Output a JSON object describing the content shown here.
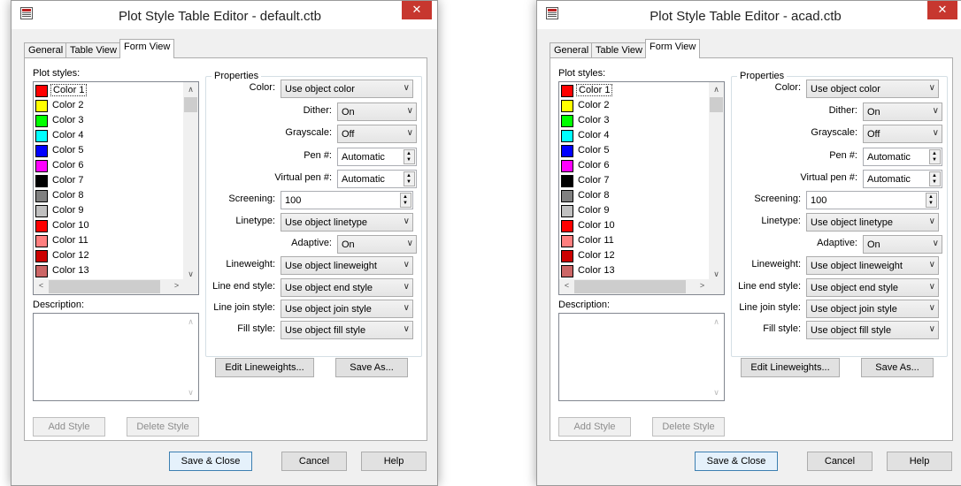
{
  "windows": [
    {
      "title": "Plot Style Table Editor - default.ctb",
      "tabs": [
        "General",
        "Table View",
        "Form View"
      ],
      "active_tab": "Form View",
      "plot_styles_label": "Plot styles:",
      "plot_styles": [
        {
          "label": "Color 1",
          "color": "#ff0000",
          "selected": true
        },
        {
          "label": "Color 2",
          "color": "#ffff00"
        },
        {
          "label": "Color 3",
          "color": "#00ff00"
        },
        {
          "label": "Color 4",
          "color": "#00ffff"
        },
        {
          "label": "Color 5",
          "color": "#0000ff"
        },
        {
          "label": "Color 6",
          "color": "#ff00ff"
        },
        {
          "label": "Color 7",
          "color": "#000000"
        },
        {
          "label": "Color 8",
          "color": "#808080"
        },
        {
          "label": "Color 9",
          "color": "#c0c0c0"
        },
        {
          "label": "Color 10",
          "color": "#ff0000"
        },
        {
          "label": "Color 11",
          "color": "#ff7f7f"
        },
        {
          "label": "Color 12",
          "color": "#cc0000"
        },
        {
          "label": "Color 13",
          "color": "#cc6666"
        }
      ],
      "description_label": "Description:",
      "add_style": "Add Style",
      "delete_style": "Delete Style",
      "properties_title": "Properties",
      "properties": {
        "color_label": "Color:",
        "color_value": "Use object color",
        "dither_label": "Dither:",
        "dither_value": "On",
        "grayscale_label": "Grayscale:",
        "grayscale_value": "Off",
        "pen_label": "Pen #:",
        "pen_value": "Automatic",
        "virtual_pen_label": "Virtual pen #:",
        "virtual_pen_value": "Automatic",
        "screening_label": "Screening:",
        "screening_value": "100",
        "linetype_label": "Linetype:",
        "linetype_value": "Use object linetype",
        "adaptive_label": "Adaptive:",
        "adaptive_value": "On",
        "lineweight_label": "Lineweight:",
        "lineweight_value": "Use object lineweight",
        "line_end_label": "Line end style:",
        "line_end_value": "Use object end style",
        "line_join_label": "Line join style:",
        "line_join_value": "Use object join style",
        "fill_label": "Fill style:",
        "fill_value": "Use object fill style"
      },
      "edit_lineweights": "Edit Lineweights...",
      "save_as": "Save As...",
      "save_close": "Save & Close",
      "cancel": "Cancel",
      "help": "Help"
    },
    {
      "title": "Plot Style Table Editor - acad.ctb",
      "tabs": [
        "General",
        "Table View",
        "Form View"
      ],
      "active_tab": "Form View",
      "plot_styles_label": "Plot styles:",
      "plot_styles": [
        {
          "label": "Color 1",
          "color": "#ff0000",
          "selected": true
        },
        {
          "label": "Color 2",
          "color": "#ffff00"
        },
        {
          "label": "Color 3",
          "color": "#00ff00"
        },
        {
          "label": "Color 4",
          "color": "#00ffff"
        },
        {
          "label": "Color 5",
          "color": "#0000ff"
        },
        {
          "label": "Color 6",
          "color": "#ff00ff"
        },
        {
          "label": "Color 7",
          "color": "#000000"
        },
        {
          "label": "Color 8",
          "color": "#808080"
        },
        {
          "label": "Color 9",
          "color": "#c0c0c0"
        },
        {
          "label": "Color 10",
          "color": "#ff0000"
        },
        {
          "label": "Color 11",
          "color": "#ff7f7f"
        },
        {
          "label": "Color 12",
          "color": "#cc0000"
        },
        {
          "label": "Color 13",
          "color": "#cc6666"
        }
      ],
      "description_label": "Description:",
      "add_style": "Add Style",
      "delete_style": "Delete Style",
      "properties_title": "Properties",
      "properties": {
        "color_label": "Color:",
        "color_value": "Use object color",
        "dither_label": "Dither:",
        "dither_value": "On",
        "grayscale_label": "Grayscale:",
        "grayscale_value": "Off",
        "pen_label": "Pen #:",
        "pen_value": "Automatic",
        "virtual_pen_label": "Virtual pen #:",
        "virtual_pen_value": "Automatic",
        "screening_label": "Screening:",
        "screening_value": "100",
        "linetype_label": "Linetype:",
        "linetype_value": "Use object linetype",
        "adaptive_label": "Adaptive:",
        "adaptive_value": "On",
        "lineweight_label": "Lineweight:",
        "lineweight_value": "Use object lineweight",
        "line_end_label": "Line end style:",
        "line_end_value": "Use object end style",
        "line_join_label": "Line join style:",
        "line_join_value": "Use object join style",
        "fill_label": "Fill style:",
        "fill_value": "Use object fill style"
      },
      "edit_lineweights": "Edit Lineweights...",
      "save_as": "Save As...",
      "save_close": "Save & Close",
      "cancel": "Cancel",
      "help": "Help"
    }
  ]
}
